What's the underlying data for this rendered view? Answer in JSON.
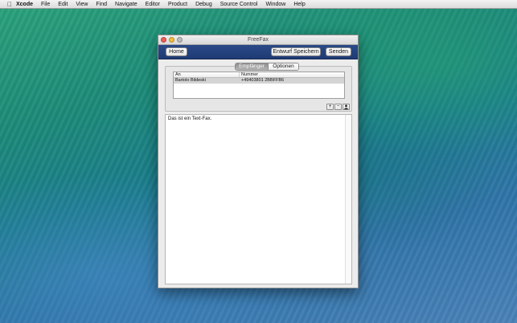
{
  "menubar": {
    "apple_icon": "apple-icon",
    "app_name": "Xcode",
    "items": [
      "File",
      "Edit",
      "View",
      "Find",
      "Navigate",
      "Editor",
      "Product",
      "Debug",
      "Source Control",
      "Window",
      "Help"
    ]
  },
  "window": {
    "title": "FreeFax",
    "toolbar": {
      "home_label": "Home",
      "draft_label": "Entwurf Speichern",
      "send_label": "Senden"
    },
    "tabs": {
      "recipients_label": "Empfänger",
      "options_label": "Optionen"
    },
    "table": {
      "columns": [
        "An",
        "Nummer"
      ],
      "rows": [
        {
          "an": "Bartolo Bildeski",
          "nummer": "+49403801 2BBFFB6"
        }
      ]
    },
    "actions": {
      "add_label": "+",
      "remove_label": "−",
      "contacts_icon": "person-icon"
    },
    "text_body": "Das ist ein Text-Fax."
  },
  "colors": {
    "toolbar_blue": "#1f3b74",
    "close": "#ec5f56",
    "minimize": "#f1bd3c"
  }
}
